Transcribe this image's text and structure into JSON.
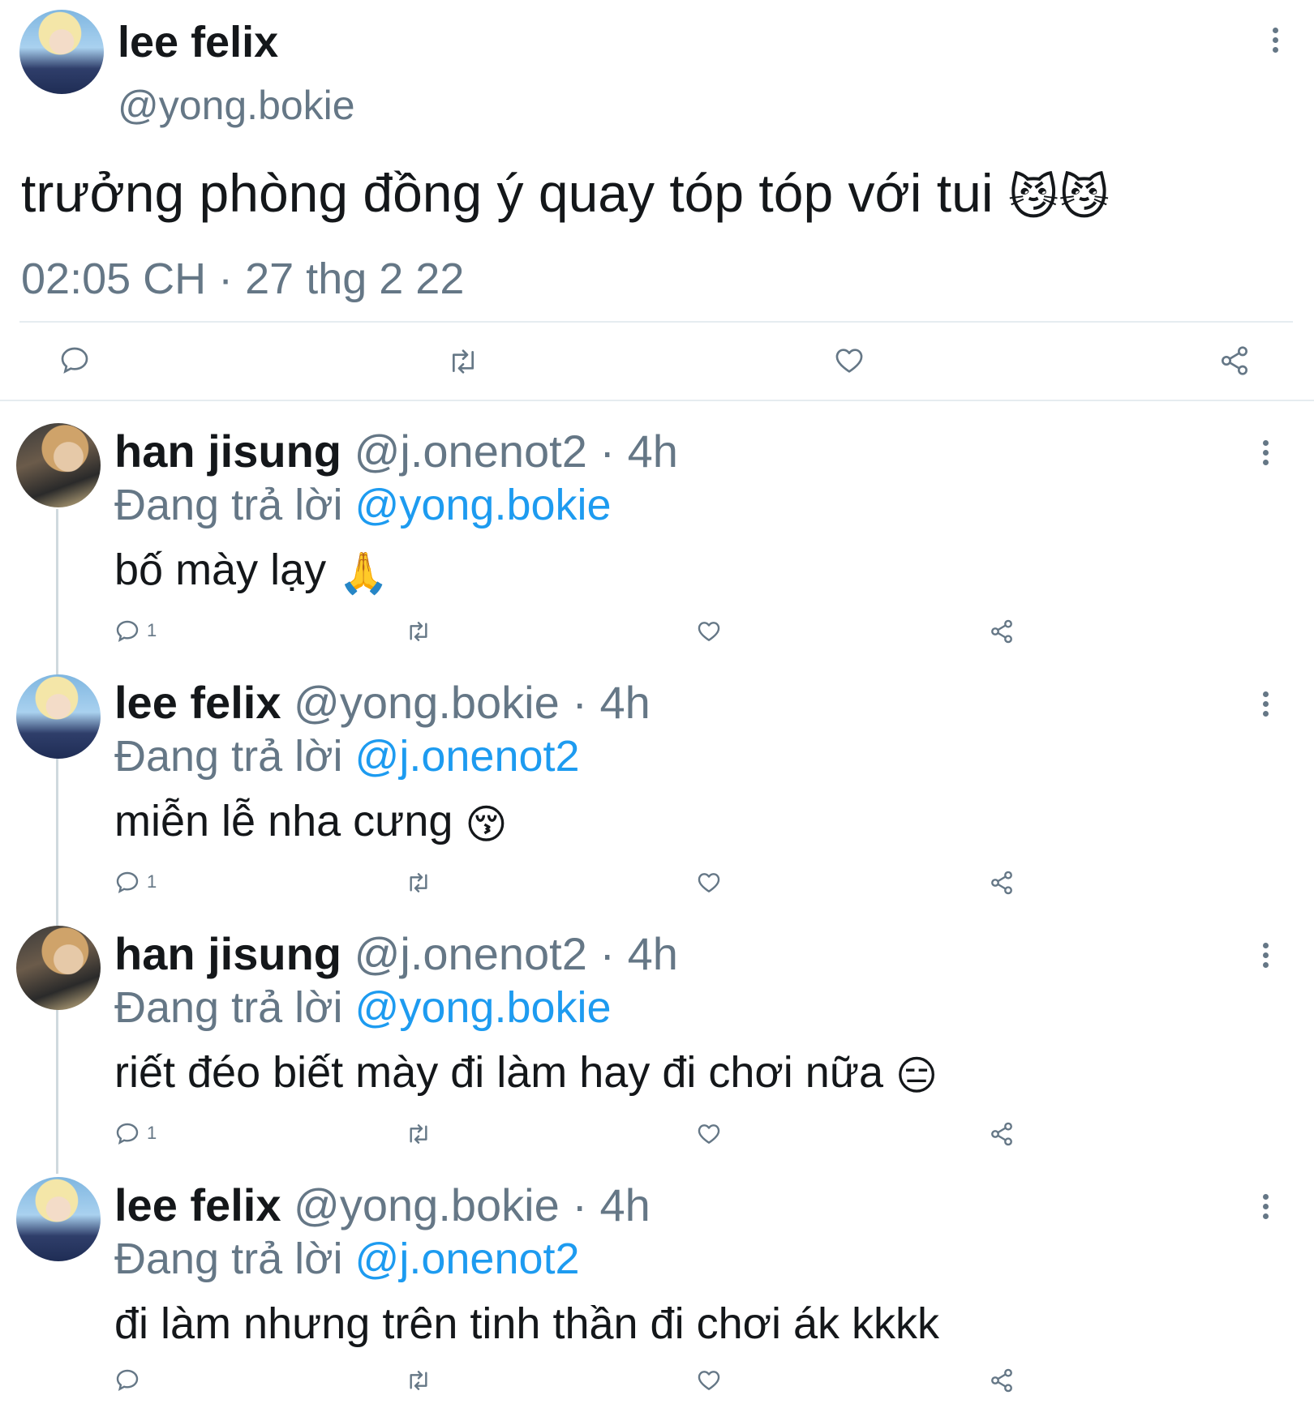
{
  "main_tweet": {
    "author_name": "lee felix",
    "handle": "@yong.bokie",
    "text": "trưởng phòng đồng ý quay tóp tóp với tui",
    "emojis": "😼😼",
    "timestamp": "02:05 CH · 27 thg 2 22",
    "icons": [
      "reply-icon",
      "retweet-icon",
      "like-icon",
      "share-icon",
      "more-icon"
    ]
  },
  "replies": [
    {
      "author_name": "han jisung",
      "handle": "@j.onenot2",
      "time": "· 4h",
      "replying_prefix": "Đang trả lời",
      "replying_to": "@yong.bokie",
      "text": "bố mày lạy",
      "emoji": "🙏",
      "reply_count": "1"
    },
    {
      "author_name": "lee felix",
      "handle": "@yong.bokie",
      "time": "· 4h",
      "replying_prefix": "Đang trả lời",
      "replying_to": "@j.onenot2",
      "text": "miễn lễ nha cưng",
      "emoji": "😚",
      "reply_count": "1"
    },
    {
      "author_name": "han jisung",
      "handle": "@j.onenot2",
      "time": "· 4h",
      "replying_prefix": "Đang trả lời",
      "replying_to": "@yong.bokie",
      "text": "riết đéo biết mày đi làm hay đi chơi nữa",
      "emoji": "😑",
      "reply_count": "1"
    },
    {
      "author_name": "lee felix",
      "handle": "@yong.bokie",
      "time": "· 4h",
      "replying_prefix": "Đang trả lời",
      "replying_to": "@j.onenot2",
      "text": "đi làm nhưng trên tinh thần đi chơi ák kkkk",
      "emoji": "",
      "reply_count": ""
    }
  ],
  "colors": {
    "link": "#1d9bf0",
    "muted": "#657786",
    "text": "#14171a"
  }
}
